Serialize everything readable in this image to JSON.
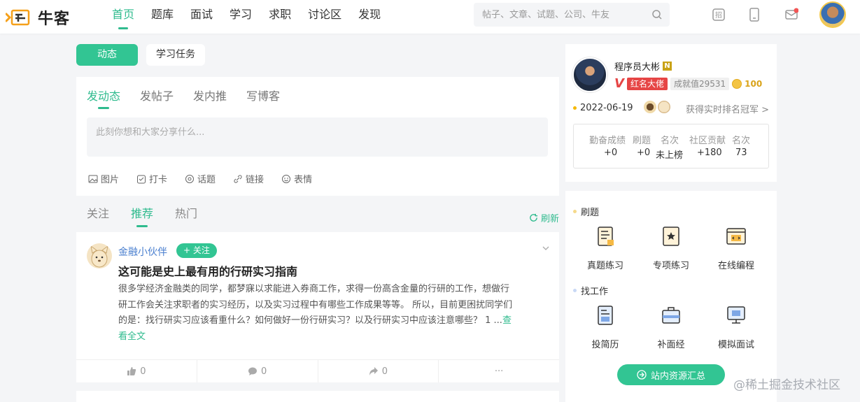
{
  "app": {
    "name": "牛客"
  },
  "nav": {
    "items": [
      "首页",
      "题库",
      "面试",
      "学习",
      "求职",
      "讨论区",
      "发现"
    ],
    "active": "首页"
  },
  "search": {
    "placeholder": "帖子、文章、试题、公司、牛友"
  },
  "top_icons": [
    "recruit-icon",
    "phone-icon",
    "mail-icon"
  ],
  "top_tabs": {
    "active": "动态",
    "other": "学习任务"
  },
  "composer": {
    "tabs": [
      "发动态",
      "发帖子",
      "发内推",
      "写博客"
    ],
    "placeholder": "此刻你想和大家分享什么...",
    "tools": [
      "图片",
      "打卡",
      "话题",
      "链接",
      "表情"
    ]
  },
  "feed": {
    "tabs": [
      "关注",
      "推荐",
      "热门"
    ],
    "active": "推荐",
    "refresh": "刷新"
  },
  "post": {
    "user": "金融小伙伴",
    "follow": "+ 关注",
    "title": "这可能是史上最有用的行研实习指南",
    "body_lines": [
      "很多学经济金融类的同学，都梦寐以求能进入券商工作，求得一份高含金量的行研的工作，想做行",
      "研工作会关注求职者的实习经历，以及实习过程中有哪些工作成果等等。 所以，目前更困扰同学们",
      "的是：找行研实习应该看重什么？如何做好一份行研实习？以及行研实习中应该注意哪些？ 1 ..."
    ],
    "more_a": "查",
    "more_b": "看全文",
    "likes": "0",
    "comments": "0",
    "shares": "0",
    "more_actions": "···"
  },
  "profile": {
    "name": "程序员大彬",
    "level_badge": "N",
    "v_mark": "V",
    "red_tag": "红名大佬",
    "score": "成就值29531",
    "coins": "100",
    "date": "2022-06-19",
    "rank_link": "获得实时排名冠军 >",
    "stats": [
      {
        "label": "勤奋成绩",
        "value": "+0"
      },
      {
        "label": "刷题",
        "value": "+0"
      },
      {
        "label": "名次",
        "value": "未上榜"
      },
      {
        "label": "社区贡献",
        "value": "+180"
      },
      {
        "label": "名次",
        "value": "73"
      }
    ]
  },
  "services": {
    "sec1": "刷题",
    "sec1_items": [
      "真题练习",
      "专项练习",
      "在线编程"
    ],
    "sec2": "找工作",
    "sec2_items": [
      "投简历",
      "补面经",
      "模拟面试"
    ],
    "summary": "站内资源汇总"
  },
  "watermark": "@稀土掘金技术社区",
  "colors": {
    "accent": "#32c593",
    "red": "#e64545",
    "gold": "#d9a31a"
  }
}
